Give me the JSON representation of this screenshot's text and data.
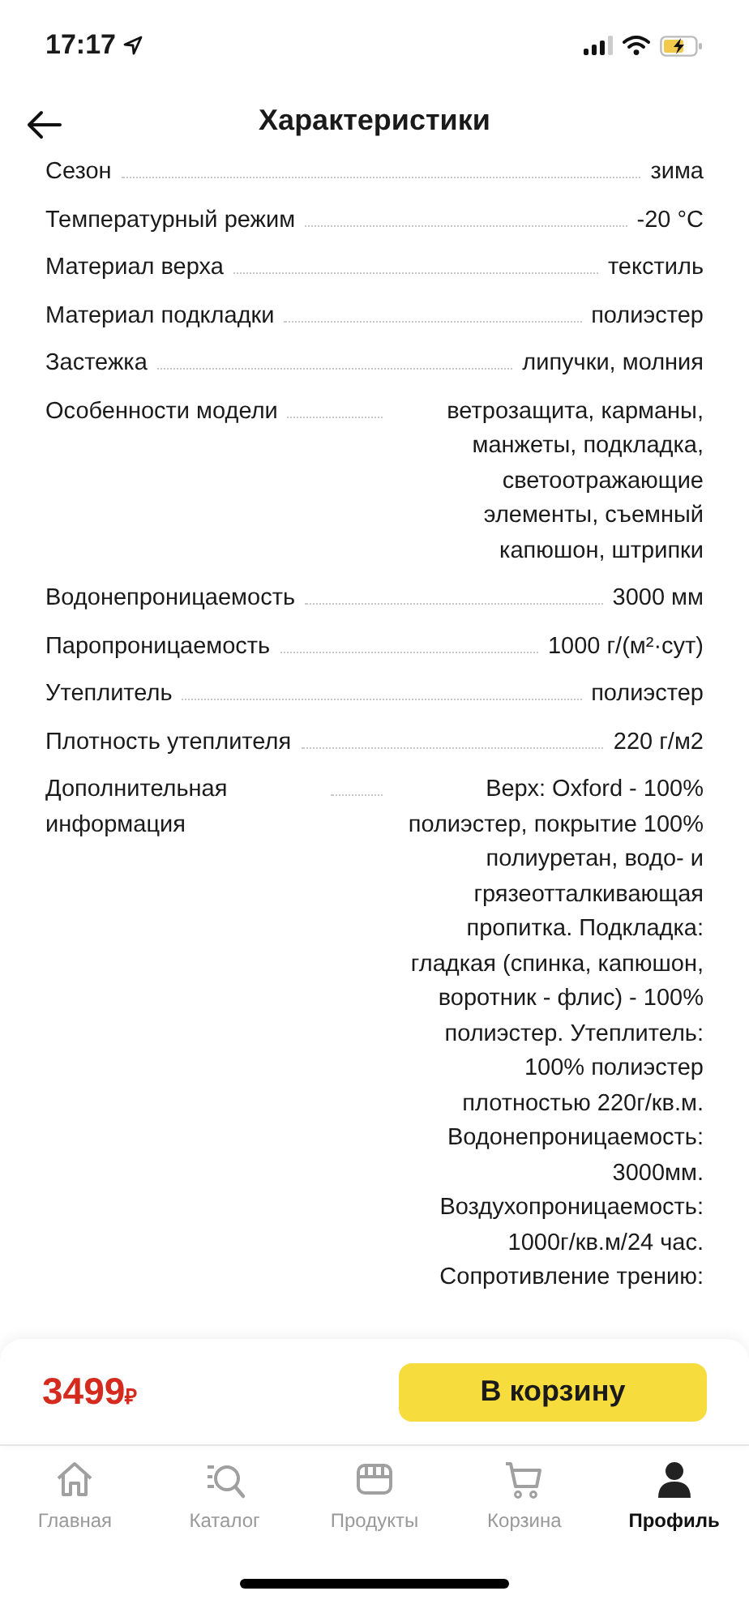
{
  "status_bar": {
    "time": "17:17"
  },
  "header": {
    "title": "Характеристики"
  },
  "specs": [
    {
      "name": "Сезон",
      "value": "зима"
    },
    {
      "name": "Температурный режим",
      "value": "-20 °C"
    },
    {
      "name": "Материал верха",
      "value": "текстиль"
    },
    {
      "name": "Материал подкладки",
      "value": "полиэстер"
    },
    {
      "name": "Застежка",
      "value": "липучки, молния"
    },
    {
      "name": "Особенности модели",
      "value": "ветрозащита, карманы, манжеты, подкладка, светоотражающие элементы, съемный капюшон, штрипки"
    },
    {
      "name": "Водонепроницаемость",
      "value": "3000 мм"
    },
    {
      "name": "Паропроницаемость",
      "value": "1000 г/(м²·сут)"
    },
    {
      "name": "Утеплитель",
      "value": "полиэстер"
    },
    {
      "name": "Плотность утеплителя",
      "value": "220 г/м2"
    },
    {
      "name": "Дополнительная информация",
      "value": "Верх: Oxford - 100% полиэстер, покрытие 100% полиуретан, водо- и грязеотталкивающая пропитка. Подкладка: гладкая (спинка, капюшон, воротник - флис) - 100% полиэстер. Утеплитель: 100% полиэстер плотностью 220г/кв.м. Водонепроницаемость: 3000мм. Воздухопроницаемость: 1000г/кв.м/24 час. Сопротивление трению:"
    }
  ],
  "buy_bar": {
    "price": "3499",
    "currency": "₽",
    "button": "В корзину"
  },
  "tabs": [
    {
      "kind": "home",
      "label": "Главная",
      "selected": false
    },
    {
      "kind": "catalog",
      "label": "Каталог",
      "selected": false
    },
    {
      "kind": "shop",
      "label": "Продукты",
      "selected": false
    },
    {
      "kind": "cart",
      "label": "Корзина",
      "selected": false
    },
    {
      "kind": "profile",
      "label": "Профиль",
      "selected": true
    }
  ]
}
